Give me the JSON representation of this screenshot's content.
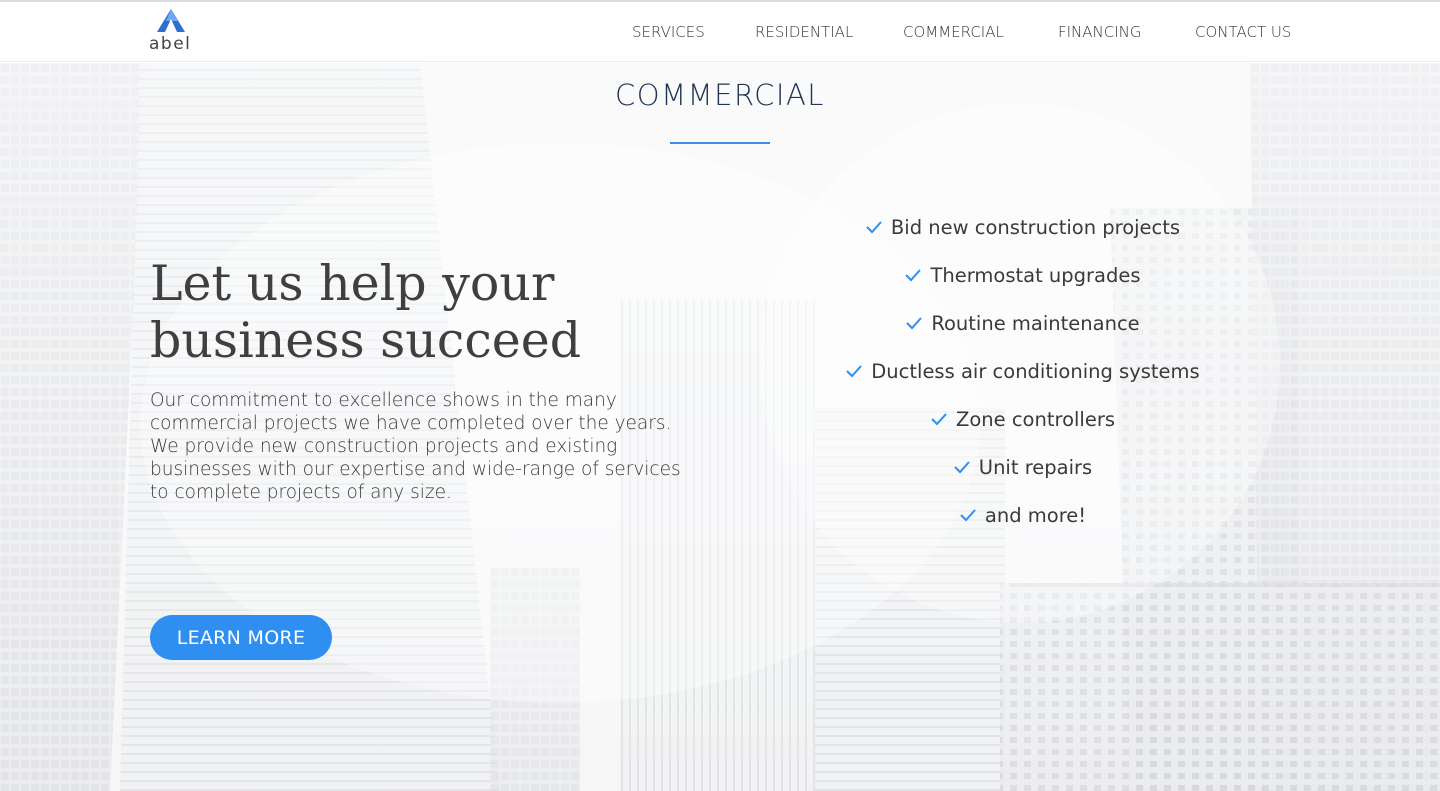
{
  "brand": {
    "logo_text": "abel",
    "accent_color": "#2e8ff0",
    "logo_color": "#2f6fd0"
  },
  "nav": {
    "items": [
      {
        "label": "SERVICES"
      },
      {
        "label": "RESIDENTIAL"
      },
      {
        "label": "COMMERCIAL"
      },
      {
        "label": "FINANCING"
      },
      {
        "label": "CONTACT US"
      }
    ]
  },
  "hero": {
    "section_title": "COMMERCIAL",
    "headline_line1": "Let us help your",
    "headline_line2": "business succeed",
    "body": "Our commitment to excellence shows in the many commercial projects we have completed over the years. We provide new construction projects and existing businesses with our expertise and wide-range of services to complete projects of any size.",
    "cta_label": "LEARN MORE",
    "background": "grayscale-skyscrapers-photo",
    "features": [
      {
        "label": "Bid new construction projects",
        "icon": "check-icon"
      },
      {
        "label": "Thermostat upgrades",
        "icon": "check-icon"
      },
      {
        "label": "Routine maintenance",
        "icon": "check-icon"
      },
      {
        "label": "Ductless air conditioning systems",
        "icon": "check-icon"
      },
      {
        "label": "Zone controllers",
        "icon": "check-icon"
      },
      {
        "label": "Unit repairs",
        "icon": "check-icon"
      },
      {
        "label": "and more!",
        "icon": "check-icon"
      }
    ]
  }
}
